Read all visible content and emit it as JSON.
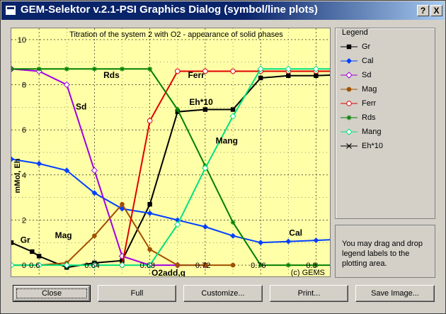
{
  "window": {
    "title": "GEM-Selektor v.2.1-PSI Graphics Dialog (symbol/line plots)",
    "help_button": "?",
    "close_button": "X"
  },
  "chart_data": {
    "type": "line",
    "title": "Titration of the system 2 with O2 - appearance of solid phases",
    "xlabel": "O2add,g",
    "ylabel": "mMol, Eh",
    "credit": "(c) GEMS",
    "xlim": [
      0.58,
      0.81
    ],
    "ylim": [
      -0.5,
      10.5
    ],
    "x_ticks": [
      "0.6",
      "0.64",
      "0.68",
      "0.72",
      "0.76",
      "0.8"
    ],
    "x_tick_values": [
      0.6,
      0.64,
      0.68,
      0.72,
      0.76,
      0.8
    ],
    "y_ticks": [
      "0",
      "2",
      "4",
      "6",
      "8",
      "10"
    ],
    "y_tick_values": [
      0,
      2,
      4,
      6,
      8,
      10
    ],
    "grid": true,
    "series": [
      {
        "name": "Gr",
        "color": "#000000",
        "marker": "square-filled",
        "x": [
          0.58,
          0.595,
          0.6,
          0.62,
          0.64,
          0.66,
          0.68,
          0.7,
          0.72,
          0.74,
          0.76,
          0.78,
          0.8,
          0.82
        ],
        "y": [
          1.0,
          0.6,
          0.4,
          -0.1,
          0.1,
          0.2,
          2.7,
          6.8,
          6.9,
          6.9,
          8.3,
          8.4,
          8.4,
          8.45
        ]
      },
      {
        "name": "Cal",
        "color": "#0040ff",
        "marker": "diamond-filled",
        "x": [
          0.58,
          0.6,
          0.62,
          0.64,
          0.66,
          0.68,
          0.7,
          0.72,
          0.74,
          0.76,
          0.78,
          0.8,
          0.82
        ],
        "y": [
          4.7,
          4.5,
          4.2,
          3.2,
          2.5,
          2.3,
          2.0,
          1.7,
          1.3,
          1.0,
          1.05,
          1.1,
          1.15
        ]
      },
      {
        "name": "Sd",
        "color": "#a000e0",
        "marker": "diamond-open",
        "x": [
          0.58,
          0.6,
          0.62,
          0.64,
          0.66,
          0.68,
          0.7,
          0.72
        ],
        "y": [
          8.7,
          8.6,
          8.0,
          4.2,
          0.4,
          0.0,
          0.0,
          0.0
        ]
      },
      {
        "name": "Mag",
        "color": "#a05000",
        "marker": "circle-filled",
        "x": [
          0.58,
          0.6,
          0.62,
          0.64,
          0.66,
          0.68,
          0.7,
          0.72,
          0.74
        ],
        "y": [
          0.0,
          0.0,
          0.1,
          1.3,
          2.7,
          0.7,
          0.0,
          0.0,
          0.0
        ]
      },
      {
        "name": "Ferr",
        "color": "#e00000",
        "marker": "circle-open",
        "x": [
          0.66,
          0.68,
          0.7,
          0.72,
          0.74,
          0.76,
          0.78,
          0.8,
          0.82
        ],
        "y": [
          0.0,
          6.4,
          8.6,
          8.6,
          8.6,
          8.6,
          8.6,
          8.6,
          8.6
        ]
      },
      {
        "name": "Rds",
        "color": "#008000",
        "marker": "star",
        "x": [
          0.58,
          0.6,
          0.62,
          0.64,
          0.66,
          0.68,
          0.7,
          0.72,
          0.74,
          0.76,
          0.78,
          0.8,
          0.82
        ],
        "y": [
          8.7,
          8.7,
          8.7,
          8.7,
          8.7,
          8.7,
          6.9,
          4.4,
          1.9,
          0.0,
          0.0,
          0.0,
          0.0
        ]
      },
      {
        "name": "Mang",
        "color": "#00e080",
        "marker": "diamond-open",
        "x": [
          0.58,
          0.6,
          0.62,
          0.64,
          0.66,
          0.68,
          0.7,
          0.72,
          0.74,
          0.76,
          0.78,
          0.8,
          0.82
        ],
        "y": [
          0.0,
          0.0,
          0.0,
          0.0,
          0.0,
          0.0,
          1.8,
          4.3,
          6.6,
          8.7,
          8.7,
          8.7,
          8.7
        ]
      },
      {
        "name": "Eh*10",
        "color": "#000000",
        "marker": "x",
        "legend_only": true,
        "x": [],
        "y": []
      }
    ],
    "annotations": [
      {
        "text": "Gr",
        "x": 0.5865,
        "y": 1.0
      },
      {
        "text": "Sd",
        "x": 0.6265,
        "y": 6.9
      },
      {
        "text": "Rds",
        "x": 0.6465,
        "y": 8.3
      },
      {
        "text": "Mag",
        "x": 0.6115,
        "y": 1.2
      },
      {
        "text": "Ferr",
        "x": 0.7075,
        "y": 8.3
      },
      {
        "text": "Eh*10",
        "x": 0.7085,
        "y": 7.1
      },
      {
        "text": "Mang",
        "x": 0.7275,
        "y": 5.4
      },
      {
        "text": "Cal",
        "x": 0.7805,
        "y": 1.3
      }
    ]
  },
  "legend": {
    "title": "Legend",
    "items": [
      {
        "label": "Gr",
        "color": "#000000",
        "marker": "square-filled"
      },
      {
        "label": "Cal",
        "color": "#0040ff",
        "marker": "diamond-filled"
      },
      {
        "label": "Sd",
        "color": "#a000e0",
        "marker": "diamond-open"
      },
      {
        "label": "Mag",
        "color": "#a05000",
        "marker": "circle-filled"
      },
      {
        "label": "Ferr",
        "color": "#e00000",
        "marker": "circle-open"
      },
      {
        "label": "Rds",
        "color": "#008000",
        "marker": "star"
      },
      {
        "label": "Mang",
        "color": "#00e080",
        "marker": "diamond-open"
      },
      {
        "label": "Eh*10",
        "color": "#000000",
        "marker": "x"
      }
    ]
  },
  "info": {
    "text": "You may drag and drop legend labels to the plotting area."
  },
  "buttons": {
    "close": "Close",
    "full": "Full",
    "customize": "Customize...",
    "print": "Print...",
    "save_image": "Save Image..."
  }
}
